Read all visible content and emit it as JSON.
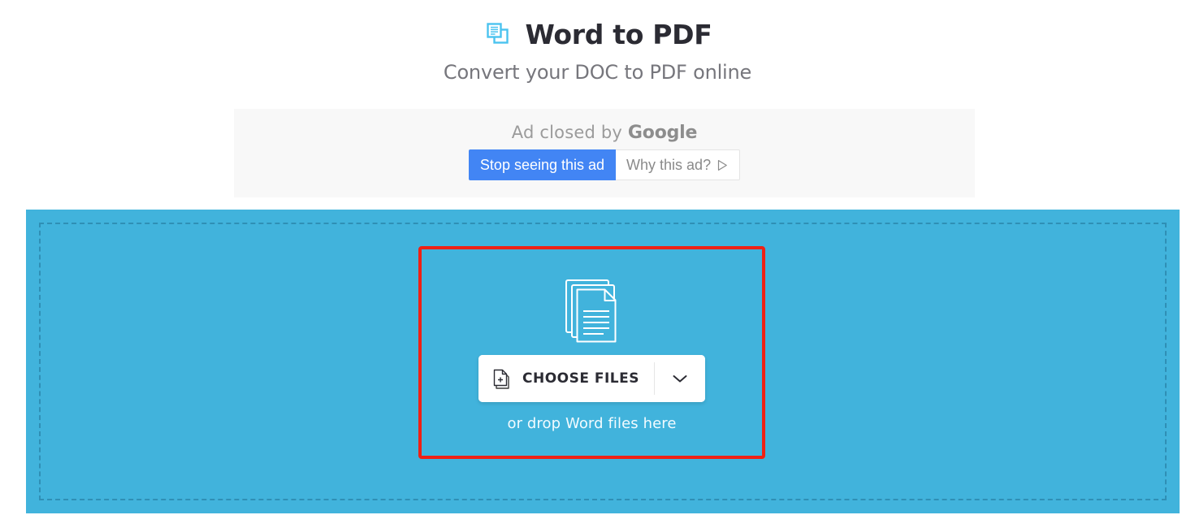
{
  "header": {
    "title": "Word to PDF",
    "subtitle": "Convert your DOC to PDF online",
    "icon": "word-to-pdf-convert-icon"
  },
  "ad": {
    "closed_prefix": "Ad closed by ",
    "brand": "Google",
    "stop_button_label": "Stop seeing this ad",
    "why_button_label": "Why this ad?",
    "why_icon": "adchoices-triangle-icon",
    "background_color": "#f8f8f8",
    "primary_color": "#4285f4"
  },
  "upload": {
    "dropzone_icon": "document-stack-icon",
    "choose_files_label": "CHOOSE FILES",
    "choose_files_icon": "document-plus-icon",
    "dropdown_icon": "chevron-down-icon",
    "drop_hint": "or drop Word files here",
    "background_color": "#41b3dc",
    "dashed_border_color": "#2f8fb5"
  },
  "annotation": {
    "highlight_color": "#ef2115",
    "target": "choose-files-dropzone"
  }
}
